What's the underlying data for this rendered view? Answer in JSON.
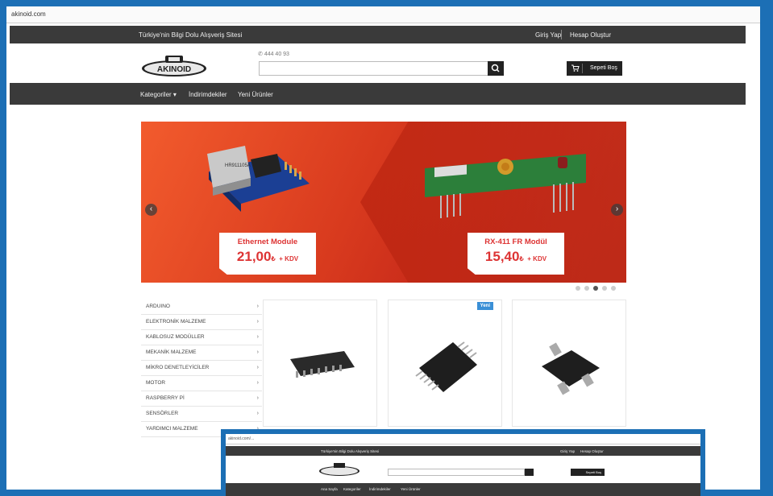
{
  "browser": {
    "url": "akinoid.com"
  },
  "topbar": {
    "slogan": "Türkiye'nin Bilgi Dolu Alışveriş Sitesi",
    "login": "Giriş Yap",
    "register": "Hesap Oluştur"
  },
  "header": {
    "logo_text": "AKINOID",
    "phone": "444 40 93",
    "search_placeholder": "",
    "cart_label": "Sepeti Boş"
  },
  "nav": {
    "items": [
      "Kategoriler ▾",
      "İndirimdekiler",
      "Yeni Ürünler"
    ]
  },
  "slider": {
    "slides": [
      {
        "name": "Ethernet Module",
        "price": "21,00",
        "currency": "₺",
        "tax": "+ KDV"
      },
      {
        "name": "RX-411 FR Modül",
        "price": "15,40",
        "currency": "₺",
        "tax": "+ KDV"
      }
    ],
    "dots": 5,
    "active_dot": 2
  },
  "categories": [
    "ARDUINO",
    "ELEKTRONİK MALZEME",
    "KABLOSUZ MODÜLLER",
    "MEKANİK MALZEME",
    "MİKRO DENETLEYİCİLER",
    "MOTOR",
    "RASPBERRY Pİ",
    "SENSÖRLER",
    "YARDIMCI MALZEME"
  ],
  "products": [
    {
      "badge": ""
    },
    {
      "badge": "Yeni"
    },
    {
      "badge": ""
    }
  ],
  "inset": {
    "url": "akinoid.com/...",
    "slogan": "Türkiye'nin Bilgi Dolu Alışveriş Sitesi",
    "login": "Giriş Yap",
    "register": "Hesap Oluştur",
    "cart_label": "Sepeti Boş",
    "nav": [
      "Ana Sayfa",
      "Kategoriler",
      "İndirimdekiler",
      "Yeni Ürünler"
    ]
  },
  "colors": {
    "frame_blue": "#1c6fb5",
    "dark_bar": "#3a3a3a",
    "banner_red": "#d83a1e",
    "accent_blue": "#3a8fd6"
  }
}
